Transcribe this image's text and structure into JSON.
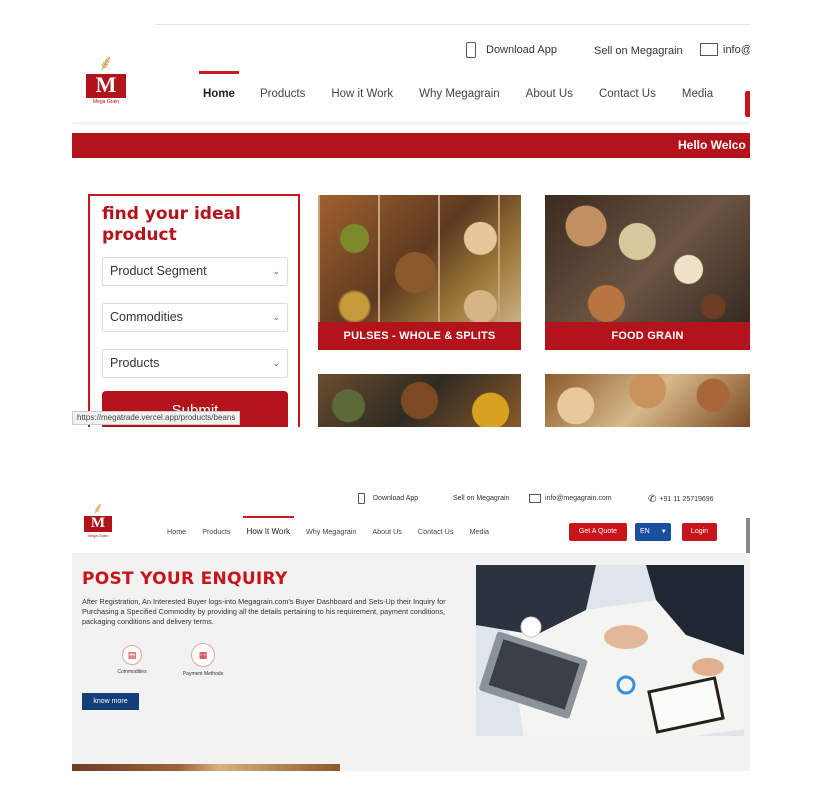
{
  "header": {
    "download_app": "Download App",
    "sell_on": "Sell on Megagrain",
    "email_partial": "info@",
    "email": "info@megagrain.com",
    "phone": "+91 11 25719696"
  },
  "logo": {
    "letter": "M",
    "tagline": "Mega Grain"
  },
  "nav_top": [
    "Home",
    "Products",
    "How it Work",
    "Why Megagrain",
    "About Us",
    "Contact Us",
    "Media"
  ],
  "nav_bottom": [
    "Home",
    "Products",
    "How It Work",
    "Why Megagrain",
    "About Us",
    "Contact Us",
    "Media"
  ],
  "banner": {
    "text": "Hello Welco"
  },
  "finder": {
    "title": "find your ideal product",
    "selects": [
      "Product Segment",
      "Commodities",
      "Products"
    ],
    "submit": "Submit"
  },
  "status_url": "https://megatrade.vercel.app/products/beans",
  "tiles": [
    {
      "caption": "PULSES - WHOLE & SPLITS"
    },
    {
      "caption": "FOOD GRAIN"
    }
  ],
  "buttons": {
    "get_quote": "Get A Quote",
    "language": "EN",
    "login": "Login"
  },
  "enquiry": {
    "title": "POST YOUR ENQUIRY",
    "body": "After Registration, An Interested Buyer logs-into Megagrain.com's Buyer Dashboard and Sets-Up their Inquiry for Purchasing a Specified Commodity by providing all the details pertaining to his requirement, payment conditions, packaging conditions and delivery terms.",
    "features": [
      "Commodities",
      "Payment Methods"
    ],
    "cta": "know more"
  },
  "icons": [
    "phone-icon",
    "mail-icon",
    "chevron-down-icon",
    "wheat-icon",
    "caret-down-icon"
  ],
  "colors": {
    "brand_red": "#b3141b",
    "button_blue": "#1a4fa0",
    "know_more_blue": "#143e7a"
  }
}
